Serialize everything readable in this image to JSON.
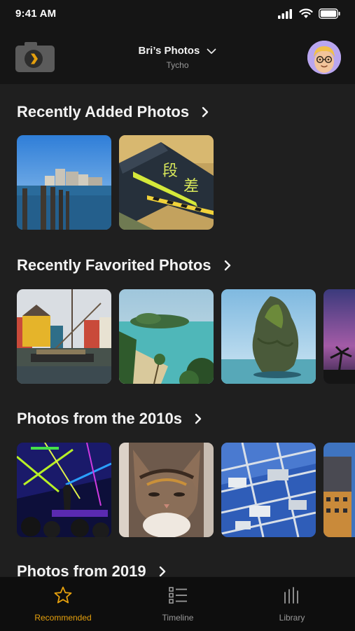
{
  "status": {
    "time": "9:41 AM"
  },
  "header": {
    "library_name": "Bri’s Photos",
    "server_name": "Tycho"
  },
  "sections": [
    {
      "title": "Recently Added Photos"
    },
    {
      "title": "Recently Favorited Photos"
    },
    {
      "title": "Photos from the 2010s"
    },
    {
      "title": "Photos from 2019"
    }
  ],
  "tabs": [
    {
      "label": "Recommended",
      "icon": "star-icon",
      "active": true
    },
    {
      "label": "Timeline",
      "icon": "list-icon",
      "active": false
    },
    {
      "label": "Library",
      "icon": "bars-icon",
      "active": false
    }
  ],
  "colors": {
    "accent": "#e5a00d",
    "background": "#1f1f1f",
    "bar": "#151515"
  }
}
